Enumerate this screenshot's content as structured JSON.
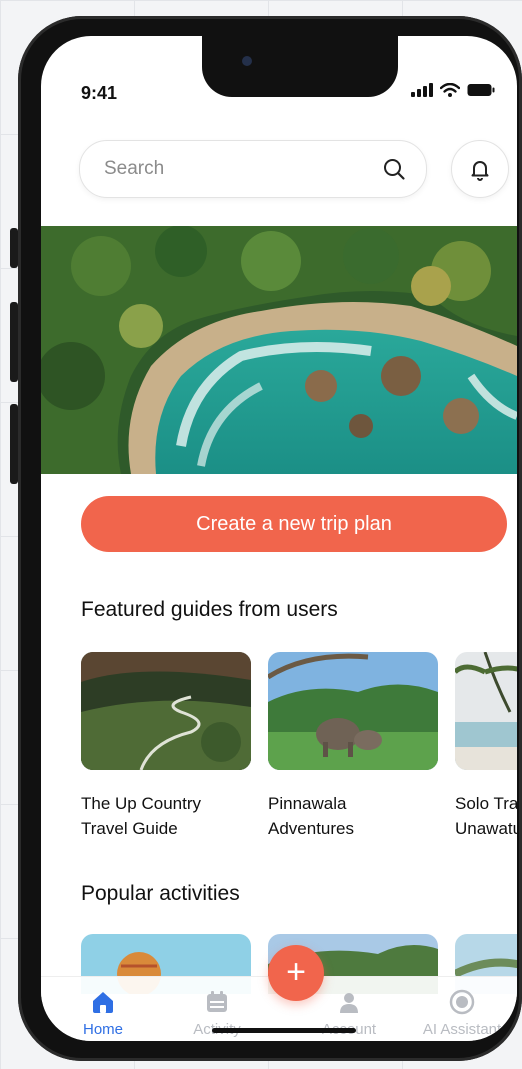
{
  "status_bar": {
    "time": "9:41"
  },
  "search": {
    "placeholder": "Search"
  },
  "cta": {
    "label": "Create a new trip plan"
  },
  "featured": {
    "title": "Featured guides from users",
    "items": [
      {
        "line1": "The Up Country",
        "line2": "Travel Guide"
      },
      {
        "line1": "Pinnawala",
        "line2": "Adventures"
      },
      {
        "line1": "Solo Trav",
        "line2": "Unawatu"
      }
    ]
  },
  "popular": {
    "title": "Popular activities"
  },
  "tab_bar": {
    "items": [
      {
        "label": "Home",
        "icon": "home-icon",
        "active": true
      },
      {
        "label": "Activity",
        "icon": "calendar-icon",
        "active": false
      },
      {
        "label": "Account",
        "icon": "person-icon",
        "active": false
      },
      {
        "label": "AI Assistant",
        "icon": "ai-assistant-icon",
        "active": false
      }
    ],
    "fab_icon": "plus-icon"
  },
  "colors": {
    "accent": "#f1654c",
    "active_tab": "#2f6fe4",
    "inactive_tab": "#b9bcc2"
  }
}
